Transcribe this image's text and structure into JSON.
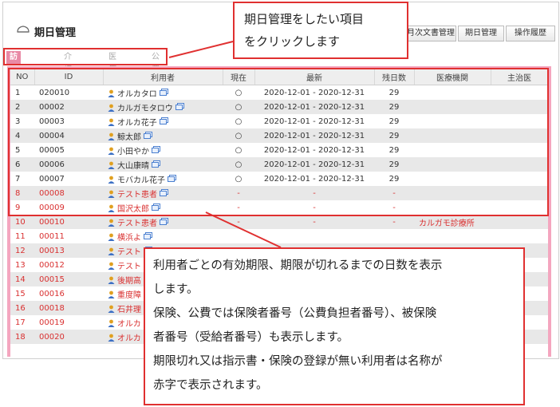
{
  "header": {
    "title": "期日管理",
    "buttons": [
      {
        "label": "月次文書管理"
      },
      {
        "label": "期日管理"
      },
      {
        "label": "操作履歴"
      }
    ]
  },
  "tabs": [
    {
      "label": "訪看指示書",
      "active": true
    },
    {
      "label": "介護保険",
      "active": false
    },
    {
      "label": "医療保険",
      "active": false
    },
    {
      "label": "公費",
      "active": false
    }
  ],
  "table": {
    "columns": [
      "NO",
      "ID",
      "利用者",
      "現在",
      "最新",
      "残日数",
      "医療機関",
      "主治医"
    ],
    "rows": [
      {
        "no": "1",
        "id": "020010",
        "name": "オルカタロ",
        "current": "○",
        "latest": "2020-12-01 - 2020-12-31",
        "days": "29",
        "hospital": "",
        "doctor": "",
        "red": false
      },
      {
        "no": "2",
        "id": "00002",
        "name": "カルガモタロウ",
        "current": "○",
        "latest": "2020-12-01 - 2020-12-31",
        "days": "29",
        "hospital": "",
        "doctor": "",
        "red": false
      },
      {
        "no": "3",
        "id": "00003",
        "name": "オルカ花子",
        "current": "○",
        "latest": "2020-12-01 - 2020-12-31",
        "days": "29",
        "hospital": "",
        "doctor": "",
        "red": false
      },
      {
        "no": "4",
        "id": "00004",
        "name": "鯨太郎",
        "current": "○",
        "latest": "2020-12-01 - 2020-12-31",
        "days": "29",
        "hospital": "",
        "doctor": "",
        "red": false
      },
      {
        "no": "5",
        "id": "00005",
        "name": "小田やか",
        "current": "○",
        "latest": "2020-12-01 - 2020-12-31",
        "days": "29",
        "hospital": "",
        "doctor": "",
        "red": false
      },
      {
        "no": "6",
        "id": "00006",
        "name": "大山康晴",
        "current": "○",
        "latest": "2020-12-01 - 2020-12-31",
        "days": "29",
        "hospital": "",
        "doctor": "",
        "red": false
      },
      {
        "no": "7",
        "id": "00007",
        "name": "モバカル花子",
        "current": "○",
        "latest": "2020-12-01 - 2020-12-31",
        "days": "29",
        "hospital": "",
        "doctor": "",
        "red": false
      },
      {
        "no": "8",
        "id": "00008",
        "name": "テスト患者",
        "current": "-",
        "latest": "-",
        "days": "-",
        "hospital": "",
        "doctor": "",
        "red": true
      },
      {
        "no": "9",
        "id": "00009",
        "name": "国沢太郎",
        "current": "-",
        "latest": "-",
        "days": "-",
        "hospital": "",
        "doctor": "",
        "red": true
      },
      {
        "no": "10",
        "id": "00010",
        "name": "テスト患者",
        "current": "-",
        "latest": "-",
        "days": "-",
        "hospital": "カルガモ診療所",
        "doctor": "",
        "red": true
      },
      {
        "no": "11",
        "id": "00011",
        "name": "横浜よ",
        "current": "",
        "latest": "",
        "days": "",
        "hospital": "",
        "doctor": "",
        "red": true
      },
      {
        "no": "12",
        "id": "00013",
        "name": "テスト",
        "current": "",
        "latest": "",
        "days": "",
        "hospital": "",
        "doctor": "",
        "red": true
      },
      {
        "no": "13",
        "id": "00012",
        "name": "テスト",
        "current": "",
        "latest": "",
        "days": "",
        "hospital": "",
        "doctor": "",
        "red": true
      },
      {
        "no": "14",
        "id": "00015",
        "name": "後期高",
        "current": "",
        "latest": "",
        "days": "",
        "hospital": "",
        "doctor": "",
        "red": true
      },
      {
        "no": "15",
        "id": "00016",
        "name": "重度障",
        "current": "",
        "latest": "",
        "days": "",
        "hospital": "",
        "doctor": "",
        "red": true
      },
      {
        "no": "16",
        "id": "00018",
        "name": "石井理",
        "current": "",
        "latest": "",
        "days": "",
        "hospital": "",
        "doctor": "",
        "red": true
      },
      {
        "no": "17",
        "id": "00019",
        "name": "オルカ",
        "current": "",
        "latest": "",
        "days": "",
        "hospital": "",
        "doctor": "",
        "red": true
      },
      {
        "no": "18",
        "id": "00020",
        "name": "オルカ",
        "current": "",
        "latest": "",
        "days": "",
        "hospital": "",
        "doctor": "",
        "red": true
      }
    ]
  },
  "callouts": {
    "top": [
      "期日管理をしたい項目",
      "をクリックします"
    ],
    "bottom": [
      "利用者ごとの有効期限、期限が切れるまでの日数を表示",
      "します。",
      "保険、公費では保険者番号（公費負担者番号）、被保険",
      "者番号（受給者番号）も表示します。",
      "期限切れ又は指示書・保険の登録が無い利用者は名称が",
      "赤字で表示されます。"
    ]
  },
  "colors": {
    "accent_pink": "#e98aa6",
    "table_border_pink": "#f4a6bf",
    "callout_red": "#e03030",
    "expired_text_red": "#d93030"
  }
}
